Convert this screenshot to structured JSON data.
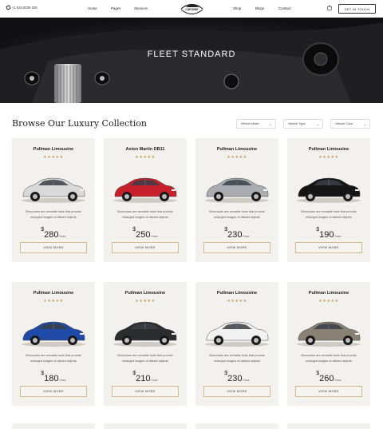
{
  "header": {
    "phone": "+1 534 6035 325",
    "nav_left": [
      "Home",
      "Pages",
      "Services"
    ],
    "nav_right": [
      "Shop",
      "Blogs",
      "Contact"
    ],
    "logo_text": "LIMOSINE",
    "cta_label": "GET IN TOUCH"
  },
  "hero": {
    "title": "FLEET STANDARD"
  },
  "collection": {
    "title": "Browse Our Luxury Collection",
    "filters": [
      "Vehicle Make",
      "Vehicle Type",
      "Vehicle Color"
    ]
  },
  "cards": [
    {
      "title": "Pullman Limousine",
      "stars": "★★★★★",
      "desc1": "Binoculars are versatile tools that provide",
      "desc2": "enlarged images of distant objects",
      "price": "280",
      "unit": "/ hour",
      "button": "VIEW MORE",
      "car_color": "#d9d9d9"
    },
    {
      "title": "Aston Martin DB11",
      "stars": "★★★★★",
      "desc1": "Binoculars are versatile tools that provide",
      "desc2": "enlarged images of distant objects",
      "price": "250",
      "unit": "/ hour",
      "button": "VIEW MORE",
      "car_color": "#c8202a"
    },
    {
      "title": "Pullman Limousine",
      "stars": "★★★★★",
      "desc1": "Binoculars are versatile tools that provide",
      "desc2": "enlarged images of distant objects",
      "price": "230",
      "unit": "/ hour",
      "button": "VIEW MORE",
      "car_color": "#a9adb2"
    },
    {
      "title": "Pullman Limousine",
      "stars": "★★★★★",
      "desc1": "Binoculars are versatile tools that provide",
      "desc2": "enlarged images of distant objects",
      "price": "190",
      "unit": "/ hour",
      "button": "VIEW MORE",
      "car_color": "#151515"
    },
    {
      "title": "Pullman Limousine",
      "stars": "★★★★★",
      "desc1": "Binoculars are versatile tools that provide",
      "desc2": "enlarged images of distant objects",
      "price": "180",
      "unit": "/ hour",
      "button": "VIEW MORE",
      "car_color": "#1f4aa8"
    },
    {
      "title": "Pullman Limousine",
      "stars": "★★★★★",
      "desc1": "Binoculars are versatile tools that provide",
      "desc2": "enlarged images of distant objects",
      "price": "210",
      "unit": "/ hour",
      "button": "VIEW MORE",
      "car_color": "#2a2c2e"
    },
    {
      "title": "Pullman Limousine",
      "stars": "★★★★★",
      "desc1": "Binoculars are versatile tools that provide",
      "desc2": "enlarged images of distant objects",
      "price": "230",
      "unit": "/ hour",
      "button": "VIEW MORE",
      "car_color": "#f2f2f2"
    },
    {
      "title": "Pullman Limousine",
      "stars": "★★★★★",
      "desc1": "Binoculars are versatile tools that provide",
      "desc2": "enlarged images of distant objects",
      "price": "260",
      "unit": "/ hour",
      "button": "VIEW MORE",
      "car_color": "#8a8175"
    }
  ],
  "accent_color": "#c79a5a",
  "icons": [
    "phone-icon",
    "cart-icon",
    "chevron-down-icon",
    "star-icon"
  ]
}
